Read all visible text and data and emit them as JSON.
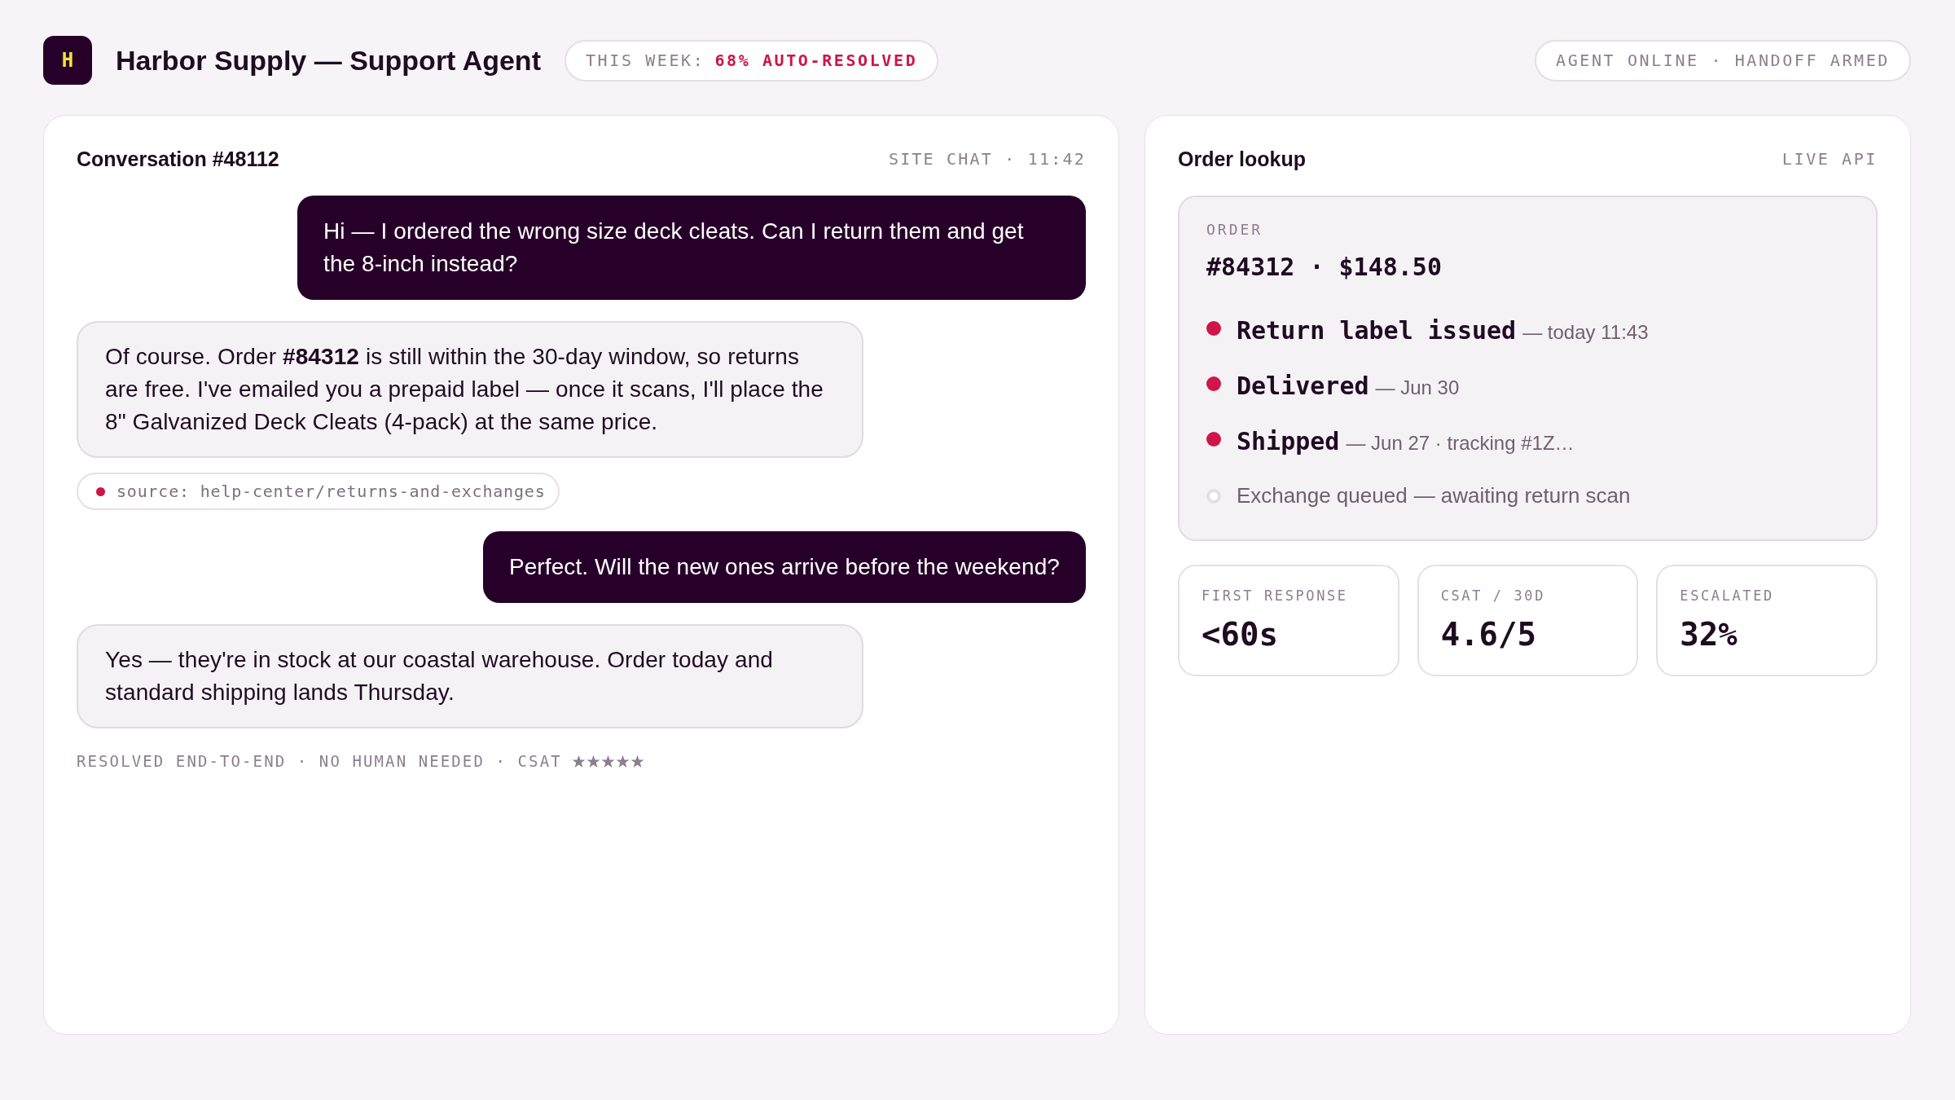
{
  "header": {
    "logo": "H",
    "title": "Harbor Supply — Support Agent",
    "weekly_stat": {
      "label": "THIS WEEK:",
      "value": "68% AUTO-RESOLVED"
    },
    "status": "AGENT ONLINE · HANDOFF ARMED"
  },
  "conversation": {
    "title": "Conversation #48112",
    "meta": "SITE CHAT · 11:42",
    "messages": [
      {
        "kind": "customer",
        "text": "Hi — I ordered the wrong size deck cleats. Can I return them and get the 8-inch instead?"
      },
      {
        "kind": "agent",
        "text": "Of course. Order **#84312** is still within the 30-day window, so returns are free. I've emailed you a prepaid label — once it scans, I'll place the 8\" Galvanized Deck Cleats (4-pack) at the same price."
      },
      {
        "kind": "source",
        "text": "source: help-center/returns-and-exchanges"
      },
      {
        "kind": "customer",
        "text": "Perfect. Will the new ones arrive before the weekend?"
      },
      {
        "kind": "agent",
        "text": "Yes — they're in stock at our coastal warehouse. Order today and standard shipping lands Thursday."
      }
    ],
    "footer": {
      "text": "RESOLVED END-TO-END · NO HUMAN NEEDED · CSAT",
      "stars": 5
    }
  },
  "order_lookup": {
    "title": "Order lookup",
    "meta": "LIVE API",
    "order": {
      "label": "ORDER",
      "summary": "#84312 · $148.50",
      "events": [
        {
          "title": "Return label issued",
          "detail": "— today 11:43",
          "done": true
        },
        {
          "title": "Delivered",
          "detail": "— Jun 30",
          "done": true
        },
        {
          "title": "Shipped",
          "detail": "— Jun 27 · tracking #1Z…",
          "done": true
        },
        {
          "title": "Exchange queued",
          "detail": "— awaiting return scan",
          "done": false
        }
      ]
    },
    "stats": [
      {
        "label": "FIRST RESPONSE",
        "value": "<60s"
      },
      {
        "label": "CSAT / 30D",
        "value": "4.6/5"
      },
      {
        "label": "ESCALATED",
        "value": "32%"
      }
    ]
  }
}
